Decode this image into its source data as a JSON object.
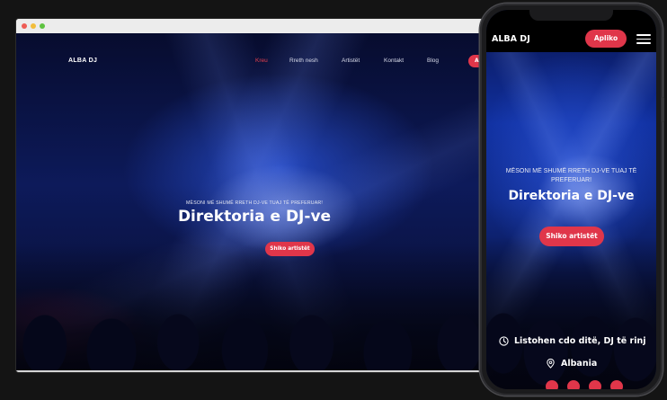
{
  "desktop": {
    "logo": "ALBA DJ",
    "nav": [
      "Kreu",
      "Rreth nesh",
      "Artistët",
      "Kontakt",
      "Blog"
    ],
    "cta_label": "Ap",
    "hero": {
      "kicker": "MËSONI MË SHUMË RRETH DJ-VE TUAJ TË PREFERUAR!",
      "title": "Direktoria e DJ-ve",
      "button_label": "Shiko artistët"
    }
  },
  "mobile": {
    "logo": "ALBA DJ",
    "cta_label": "Apliko",
    "menu_icon": "hamburger-icon",
    "hero": {
      "kicker": "MËSONI MË SHUMË RRETH DJ-VE TUAJ TË PREFERUAR!",
      "title": "Direktoria e DJ-ve",
      "button_label": "Shiko artistët"
    },
    "info": {
      "schedule_icon": "clock-icon",
      "schedule": "Listohen cdo ditë, DJ të rinj",
      "location_icon": "location-pin-icon",
      "location": "Albania"
    }
  },
  "colors": {
    "accent": "#e0364a",
    "background": "#141414"
  }
}
